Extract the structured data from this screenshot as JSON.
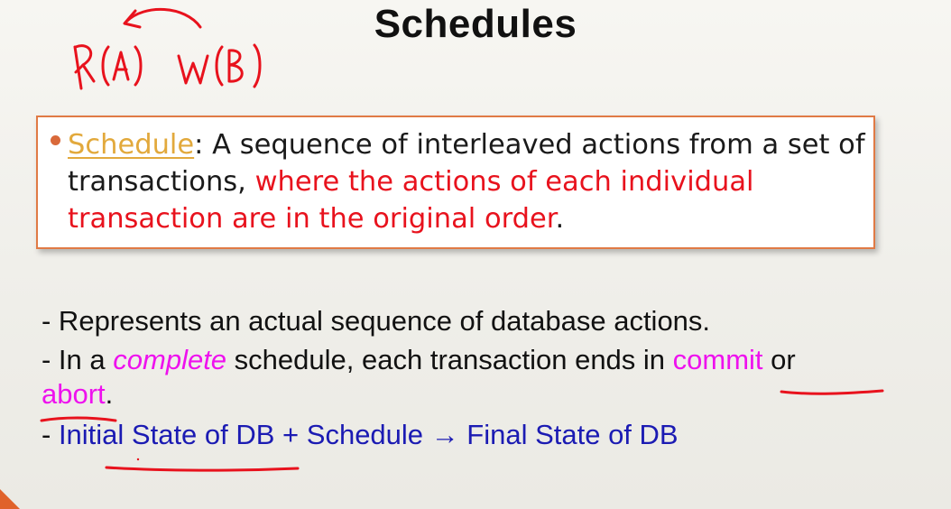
{
  "slide": {
    "title": "Schedules",
    "handwritten_note": "R(A) W(B)"
  },
  "definition": {
    "term": "Schedule",
    "separator": ": ",
    "text_plain": "A sequence of interleaved actions from a set of transactions, ",
    "text_emphasis": "where the actions of each individual transaction are in the original order",
    "text_end": "."
  },
  "points": {
    "line1": "- Represents an actual sequence of database actions.",
    "line2_prefix": "- In a ",
    "line2_italic": "complete",
    "line2_mid": " schedule, each transaction ends in ",
    "line2_commit": "commit",
    "line2_or": " or",
    "line3_abort": "abort",
    "line3_end": ".",
    "line4_dash": "- ",
    "line4_text": "Initial State of DB + Schedule → Final State of DB"
  },
  "colors": {
    "title": "#111111",
    "term": "#e2a93c",
    "emphasis_red": "#e8121d",
    "magenta": "#ee11ee",
    "blue": "#1b1bb3",
    "box_border": "#e07a45",
    "ink_red": "#e8121d"
  }
}
